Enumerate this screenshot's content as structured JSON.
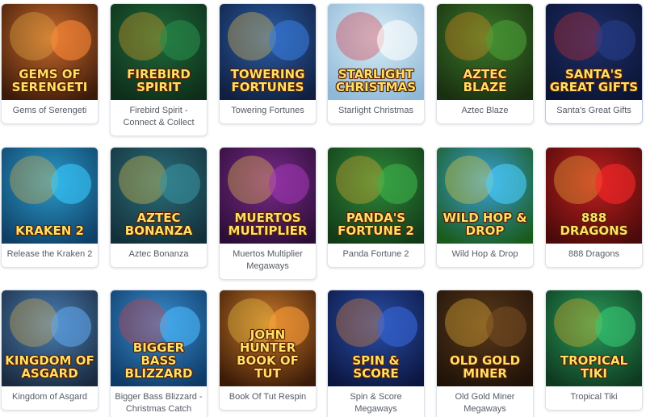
{
  "games": [
    {
      "name": "Gems of Serengeti",
      "art": "Gems of Serengeti",
      "colors": [
        "#c96a2b",
        "#3c1a0a",
        "#e8b44a"
      ]
    },
    {
      "name": "Firebird Spirit - Connect & Collect",
      "art": "Firebird Spirit",
      "colors": [
        "#1f6b3a",
        "#0e2d1a",
        "#f2a22b"
      ]
    },
    {
      "name": "Towering Fortunes",
      "art": "Towering Fortunes",
      "colors": [
        "#2b5ea8",
        "#101f40",
        "#f5c94a"
      ]
    },
    {
      "name": "Starlight Christmas",
      "art": "Starlight Christmas",
      "colors": [
        "#d9eef7",
        "#8fb8d6",
        "#d62b3a"
      ]
    },
    {
      "name": "Aztec Blaze",
      "art": "Aztec Blaze",
      "colors": [
        "#3a7a2a",
        "#1a2e10",
        "#f08c1f"
      ]
    },
    {
      "name": "Santa's Great Gifts",
      "art": "Santa's Great Gifts",
      "colors": [
        "#1e2f6b",
        "#0b1433",
        "#d43030"
      ]
    },
    {
      "name": "Release the Kraken 2",
      "art": "Kraken 2",
      "colors": [
        "#2a9bc9",
        "#0f3f66",
        "#f0b840"
      ]
    },
    {
      "name": "Aztec Bonanza",
      "art": "Aztec Bonanza",
      "colors": [
        "#2b6f7a",
        "#13303a",
        "#f2c84a"
      ]
    },
    {
      "name": "Muertos Multiplier Megaways",
      "art": "Muertos Multiplier",
      "colors": [
        "#7a2a8a",
        "#2b0e36",
        "#f5d14a"
      ]
    },
    {
      "name": "Panda Fortune 2",
      "art": "Panda's Fortune 2",
      "colors": [
        "#2f8a3a",
        "#123a18",
        "#f2b030"
      ]
    },
    {
      "name": "Wild Hop & Drop",
      "art": "Wild Hop & Drop",
      "colors": [
        "#3aa0d8",
        "#1a5a1a",
        "#f5d43a"
      ]
    },
    {
      "name": "888 Dragons",
      "art": "888 Dragons",
      "colors": [
        "#c21f1f",
        "#4a0a0a",
        "#f5c040"
      ]
    },
    {
      "name": "Kingdom of Asgard",
      "art": "Kingdom of Asgard",
      "colors": [
        "#4a7fb5",
        "#1a2b40",
        "#e8b44a"
      ]
    },
    {
      "name": "Bigger Bass Blizzard - Christmas Catch",
      "art": "Bigger Bass Blizzard",
      "colors": [
        "#3a8fd0",
        "#0e3a66",
        "#e83a3a"
      ]
    },
    {
      "name": "Book Of Tut Respin",
      "art": "John Hunter Book of Tut",
      "colors": [
        "#c97a2a",
        "#3a1a08",
        "#f5d14a"
      ]
    },
    {
      "name": "Spin & Score Megaways",
      "art": "Spin & Score",
      "colors": [
        "#2a4fa8",
        "#0b1640",
        "#f58a2a"
      ]
    },
    {
      "name": "Old Gold Miner Megaways",
      "art": "Old Gold Miner",
      "colors": [
        "#5a3a1a",
        "#1f1208",
        "#f5c040"
      ]
    },
    {
      "name": "Tropical Tiki",
      "art": "Tropical Tiki",
      "colors": [
        "#2a9a5a",
        "#0e3a20",
        "#f5b82a"
      ]
    }
  ]
}
